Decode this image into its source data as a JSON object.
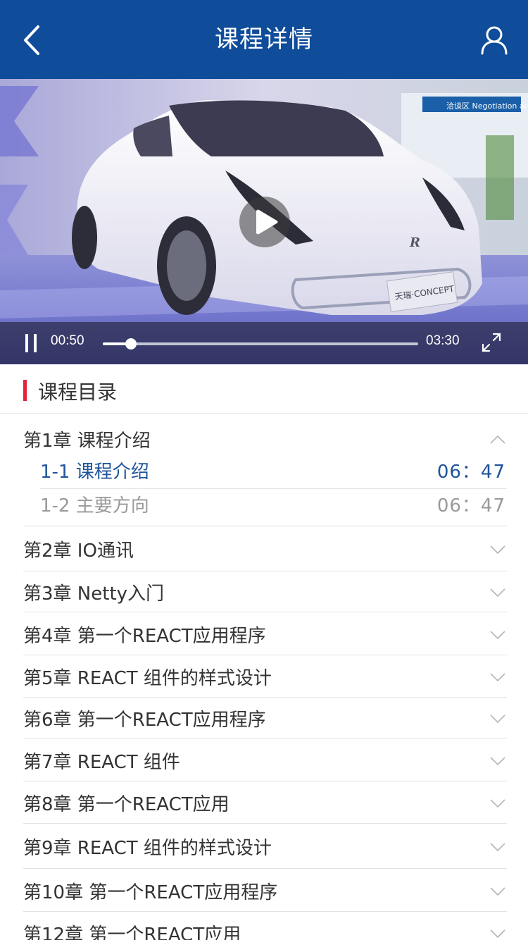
{
  "header": {
    "title": "课程详情",
    "back_icon": "chevron-left-icon",
    "user_icon": "user-icon",
    "bg_color": "#0f4c9a"
  },
  "video": {
    "current_time": "00:50",
    "total_time": "03:30",
    "progress": 0.09,
    "pause_icon": "pause-icon",
    "play_icon": "play-icon",
    "fullscreen_icon": "fullscreen-icon",
    "plate_text": "天瑞·CONCEPT",
    "sign_text": "洽谈区 Negotiation area"
  },
  "catalog": {
    "title": "课程目录",
    "accent_color": "#e4233d",
    "active_color": "#1f5499",
    "chapters": [
      {
        "title": "第1章 课程介绍",
        "expanded": true,
        "lessons": [
          {
            "title": "1-1 课程介绍",
            "duration": "06：47",
            "active": true
          },
          {
            "title": "1-2 主要方向",
            "duration": "06：47",
            "active": false
          }
        ]
      },
      {
        "title": "第2章 IO通讯",
        "expanded": false
      },
      {
        "title": "第3章 Netty入门",
        "expanded": false
      },
      {
        "title": "第4章 第一个REACT应用程序",
        "expanded": false
      },
      {
        "title": "第5章 REACT 组件的样式设计",
        "expanded": false
      },
      {
        "title": "第6章 第一个REACT应用程序",
        "expanded": false
      },
      {
        "title": "第7章 REACT 组件",
        "expanded": false
      },
      {
        "title": "第8章 第一个REACT应用",
        "expanded": false
      },
      {
        "title": "第9章 REACT 组件的样式设计",
        "expanded": false
      },
      {
        "title": "第10章 第一个REACT应用程序",
        "expanded": false
      },
      {
        "title": "第12章 第一个REACT应用",
        "expanded": false
      }
    ]
  }
}
